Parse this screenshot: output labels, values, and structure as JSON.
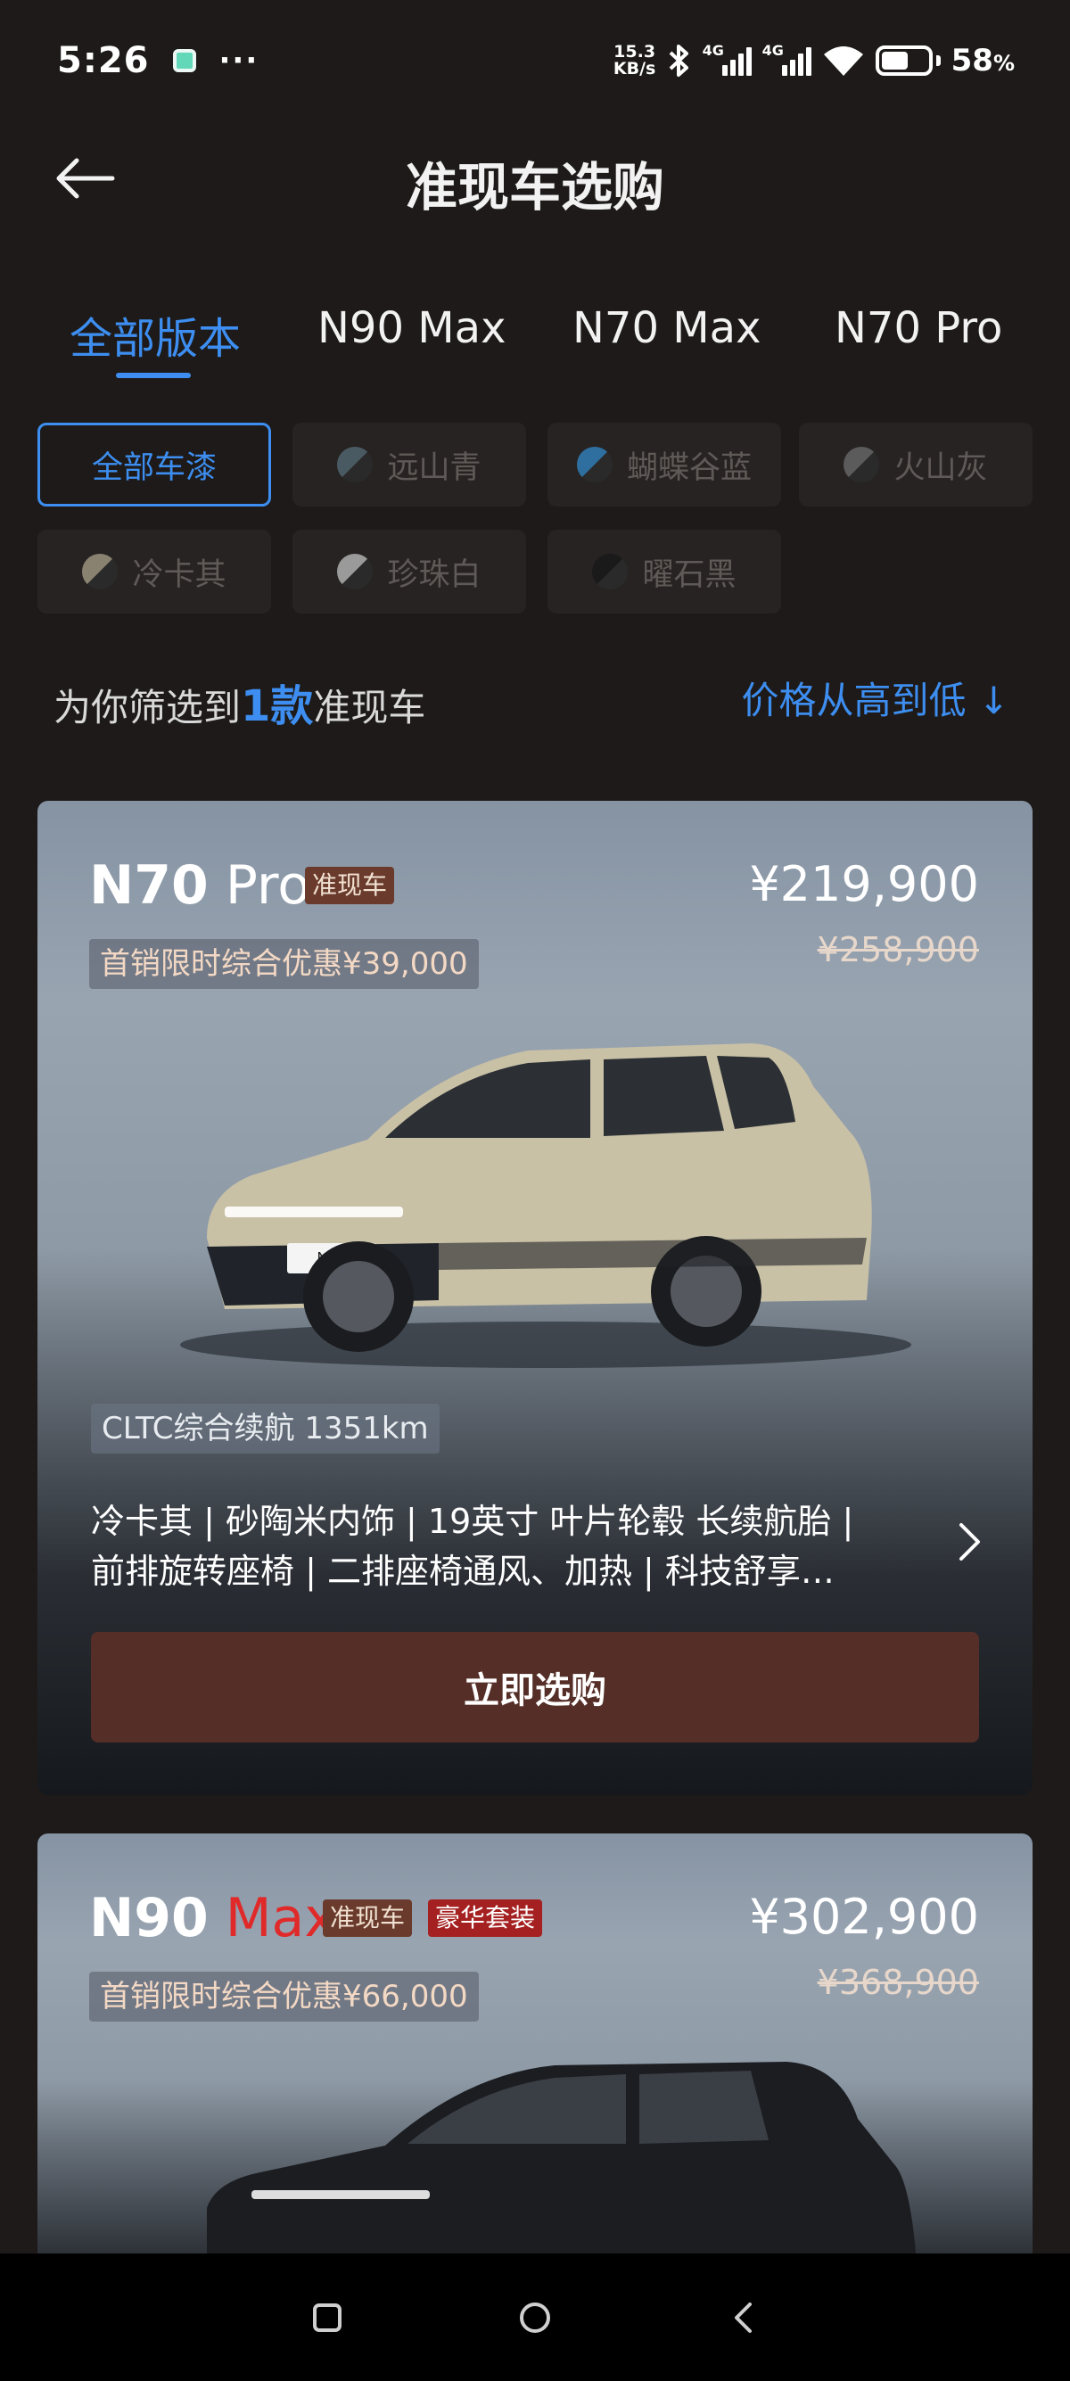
{
  "status": {
    "time": "5:26",
    "net_speed_value": "15.3",
    "net_speed_unit": "KB/s",
    "sig1_label": "4G",
    "sig2_label": "4G",
    "battery_text": "58",
    "battery_unit": "%",
    "battery_level": 0.58
  },
  "header": {
    "title": "准现车选购"
  },
  "tabs": [
    {
      "label": "全部版本"
    },
    {
      "label": "N90 Max"
    },
    {
      "label": "N70 Max"
    },
    {
      "label": "N70 Pro"
    }
  ],
  "colors": [
    {
      "label": "全部车漆"
    },
    {
      "label": "远山青",
      "swatch": "#4a5a63"
    },
    {
      "label": "蝴蝶谷蓝",
      "swatch": "#2f6fa0"
    },
    {
      "label": "火山灰",
      "swatch": "#5b5b5b"
    },
    {
      "label": "冷卡其",
      "swatch": "#8a8270"
    },
    {
      "label": "珍珠白",
      "swatch": "#9a9a9a"
    },
    {
      "label": "曜石黑",
      "swatch": "#1a1a1a"
    }
  ],
  "results": {
    "prefix": "为你筛选到",
    "count": "1款",
    "suffix": "准现车",
    "sort": "价格从高到低 ↓"
  },
  "cards": [
    {
      "model_a": "N70",
      "model_b": " Pro",
      "tag": "准现车",
      "price": "¥219,900",
      "orig_price": "¥258,900",
      "promo": "首销限时综合优惠¥39,000",
      "range": "CLTC综合续航 1351km",
      "feature_line1": "冷卡其 | 砂陶米内饰 | 19英寸 叶片轮毂 长续航胎 |",
      "feature_line2": "前排旋转座椅 | 二排座椅通风、加热 | 科技舒享…",
      "button": "立即选购",
      "plate": "N70"
    },
    {
      "model_a": "N90",
      "model_b": " Max",
      "tag": "准现车",
      "tag2": "豪华套装",
      "price": "¥302,900",
      "orig_price": "¥368,900",
      "promo": "首销限时综合优惠¥66,000"
    }
  ],
  "theme": {
    "accent": "#3d8ef0",
    "button_bg": "#552e27",
    "background": "#1d1a19"
  }
}
